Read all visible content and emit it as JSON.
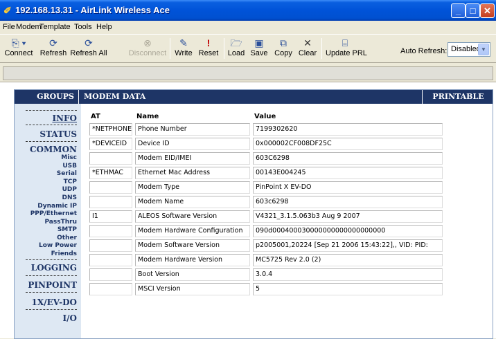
{
  "window": {
    "title": "192.168.13.31 - AirLink Wireless Ace",
    "controls": {
      "minimize": "_",
      "maximize": "□",
      "close": "✕"
    }
  },
  "menu": [
    "File",
    "Modem",
    "Template",
    "Tools",
    "Help"
  ],
  "toolbar": {
    "connect": "Connect",
    "refresh": "Refresh",
    "refresh_all": "Refresh All",
    "disconnect": "Disconnect",
    "write": "Write",
    "reset": "Reset",
    "load": "Load",
    "save": "Save",
    "copy": "Copy",
    "clear": "Clear",
    "update_prl": "Update PRL",
    "auto_refresh_label": "Auto Refresh:",
    "auto_refresh_value": "Disabled"
  },
  "panel": {
    "groups_header": "GROUPS",
    "modem_data_header": "MODEM DATA",
    "printable_view": "PRINTABLE VIEW"
  },
  "sidebar": {
    "info": "INFO",
    "status": "STATUS",
    "common": "COMMON",
    "misc": "Misc",
    "usb": "USB",
    "serial": "Serial",
    "tcp": "TCP",
    "udp": "UDP",
    "dns": "DNS",
    "dynamic_ip": "Dynamic IP",
    "ppp_ethernet": "PPP/Ethernet",
    "passthru": "PassThru",
    "smtp": "SMTP",
    "other": "Other",
    "low_power": "Low Power",
    "friends": "Friends",
    "logging": "LOGGING",
    "pinpoint": "PINPOINT",
    "ev_do": "1X/EV-DO",
    "io": "I/O"
  },
  "table": {
    "headers": {
      "at": "AT",
      "name": "Name",
      "value": "Value"
    },
    "rows": [
      {
        "at": "*NETPHONE",
        "name": "Phone Number",
        "value": "7199302620"
      },
      {
        "at": "*DEVICEID",
        "name": "Device ID",
        "value": "0x000002CF008DF25C"
      },
      {
        "at": "",
        "name": "Modem EID/IMEI",
        "value": "603C6298"
      },
      {
        "at": "*ETHMAC",
        "name": "Ethernet Mac Address",
        "value": "00143E004245"
      },
      {
        "at": "",
        "name": "Modem Type",
        "value": "PinPoint X EV-DO"
      },
      {
        "at": "",
        "name": "Modem Name",
        "value": "603c6298"
      },
      {
        "at": "I1",
        "name": "ALEOS Software Version",
        "value": "V4321_3.1.5.063b3 Aug 9 2007"
      },
      {
        "at": "",
        "name": "Modem Hardware Configuration",
        "value": "090d000400030000000000000000000"
      },
      {
        "at": "",
        "name": "Modem Software Version",
        "value": "p2005001,20224 [Sep 21 2006 15:43:22],, VID: PID:"
      },
      {
        "at": "",
        "name": "Modem Hardware Version",
        "value": "MC5725 Rev 2.0 (2)"
      },
      {
        "at": "",
        "name": "Boot Version",
        "value": "3.0.4"
      },
      {
        "at": "",
        "name": "MSCI Version",
        "value": "5"
      }
    ]
  }
}
